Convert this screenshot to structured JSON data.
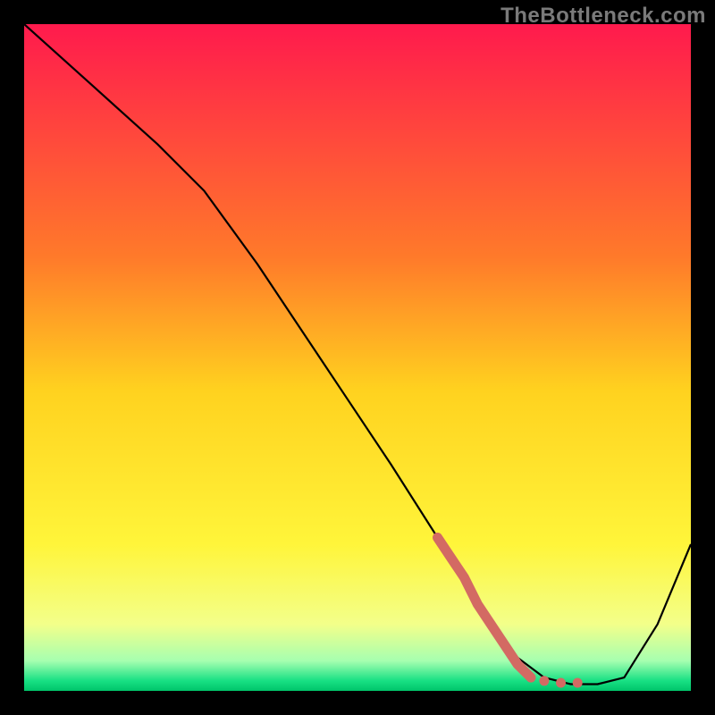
{
  "watermark": "TheBottleneck.com",
  "chart_data": {
    "type": "line",
    "title": "",
    "xlabel": "",
    "ylabel": "",
    "xlim": [
      0,
      100
    ],
    "ylim": [
      0,
      100
    ],
    "background_gradient": {
      "stops": [
        {
          "pos": 0.0,
          "color": "#ff1a4d"
        },
        {
          "pos": 0.35,
          "color": "#ff7a2a"
        },
        {
          "pos": 0.55,
          "color": "#ffd21f"
        },
        {
          "pos": 0.78,
          "color": "#fff53a"
        },
        {
          "pos": 0.9,
          "color": "#f3ff8a"
        },
        {
          "pos": 0.955,
          "color": "#a6ffb0"
        },
        {
          "pos": 0.985,
          "color": "#17e083"
        },
        {
          "pos": 1.0,
          "color": "#00c46a"
        }
      ]
    },
    "series": [
      {
        "name": "bottleneck-curve",
        "stroke": "#000000",
        "stroke_width": 2.2,
        "x": [
          0,
          10,
          20,
          27,
          35,
          45,
          55,
          62,
          67,
          70,
          74,
          78,
          82,
          86,
          90,
          95,
          100
        ],
        "values": [
          100,
          91,
          82,
          75,
          64,
          49,
          34,
          23,
          15,
          10,
          5,
          2,
          1,
          1,
          2,
          10,
          22
        ]
      },
      {
        "name": "highlight-segment",
        "stroke": "#d36a63",
        "stroke_width": 11,
        "style": "solid-then-dotted",
        "x": [
          62,
          64,
          66,
          68,
          70,
          72,
          74,
          76
        ],
        "values": [
          23,
          20,
          17,
          13,
          10,
          7,
          4,
          2
        ],
        "dotted_tail_x": [
          78,
          80.5,
          83
        ],
        "dotted_tail_values": [
          1.5,
          1.2,
          1.2
        ]
      }
    ]
  }
}
